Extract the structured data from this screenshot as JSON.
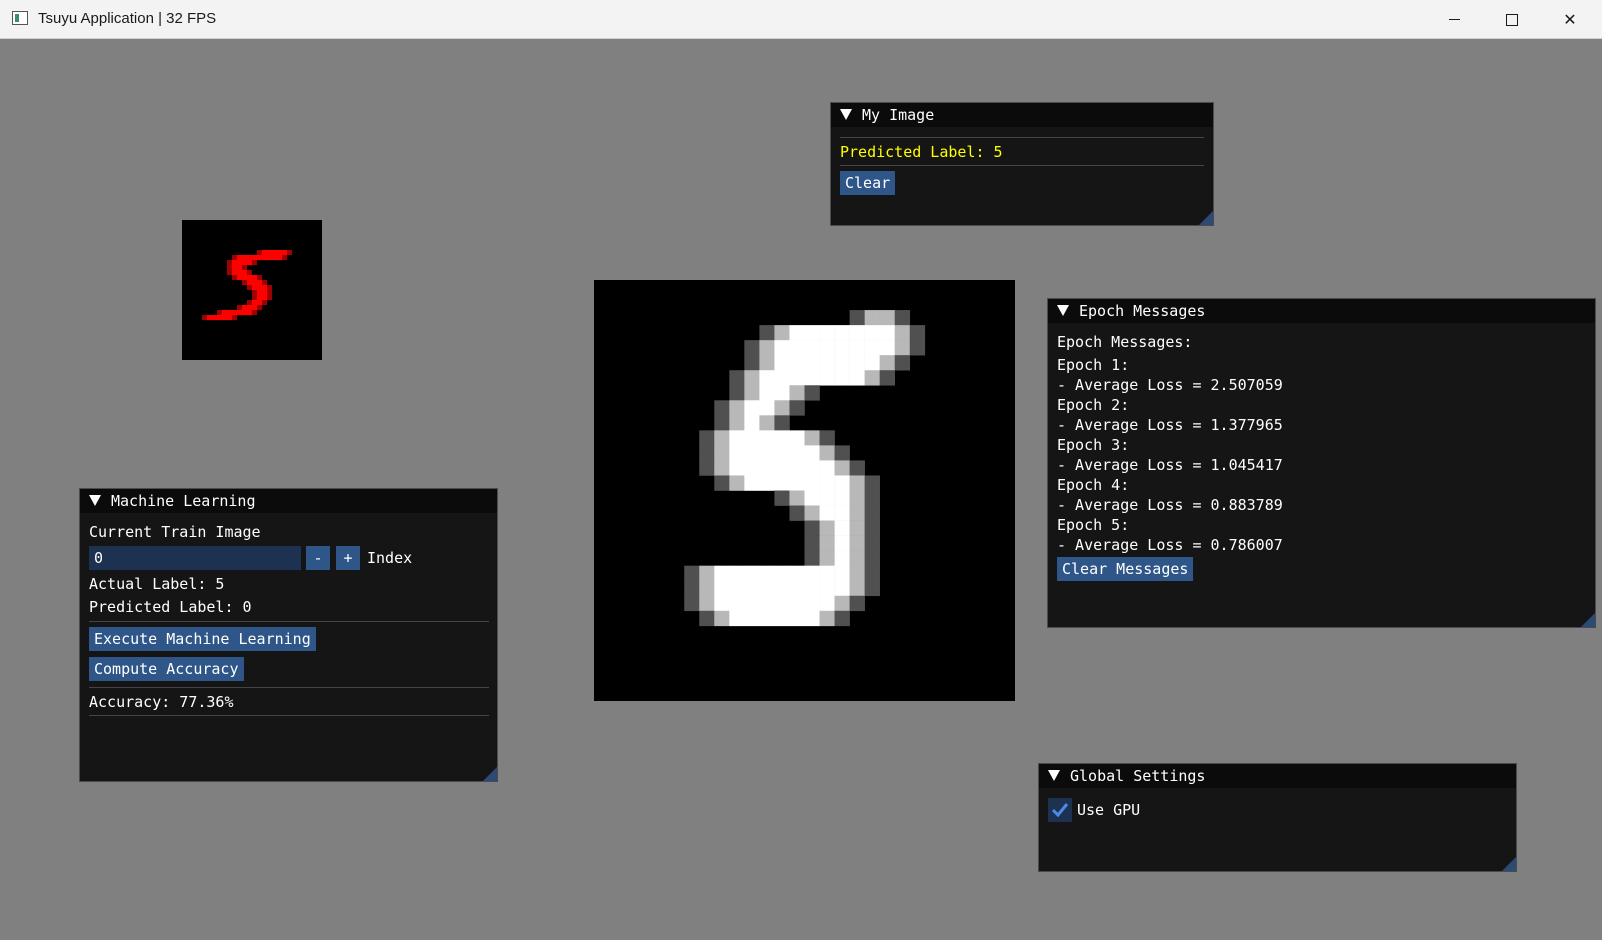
{
  "window": {
    "title": "Tsuyu Application | 32 FPS"
  },
  "my_image": {
    "title": "My Image",
    "predicted_label": "Predicted Label: 5",
    "clear_label": "Clear"
  },
  "epoch_messages": {
    "title": "Epoch Messages",
    "header": "Epoch Messages:",
    "entries": [
      {
        "epoch": "Epoch 1:",
        "loss": "- Average Loss = 2.507059"
      },
      {
        "epoch": "Epoch 2:",
        "loss": "- Average Loss = 1.377965"
      },
      {
        "epoch": "Epoch 3:",
        "loss": "- Average Loss = 1.045417"
      },
      {
        "epoch": "Epoch 4:",
        "loss": "- Average Loss = 0.883789"
      },
      {
        "epoch": "Epoch 5:",
        "loss": "- Average Loss = 0.786007"
      }
    ],
    "clear_label": "Clear Messages"
  },
  "machine_learning": {
    "title": "Machine Learning",
    "current_train_image": "Current Train Image",
    "index_value": "0",
    "minus_label": "-",
    "plus_label": "+",
    "index_label": "Index",
    "actual_label": "Actual Label: 5",
    "predicted_label": "Predicted Label: 0",
    "execute_label": "Execute Machine Learning",
    "compute_label": "Compute Accuracy",
    "accuracy": "Accuracy: 77.36%"
  },
  "global_settings": {
    "title": "Global Settings",
    "use_gpu_label": "Use GPU",
    "use_gpu": true
  },
  "colors": {
    "background": "#808080",
    "panel": "#151515",
    "accent": "#2f5688",
    "highlight_text": "#ffff00",
    "train_digit": "#ff0000"
  }
}
